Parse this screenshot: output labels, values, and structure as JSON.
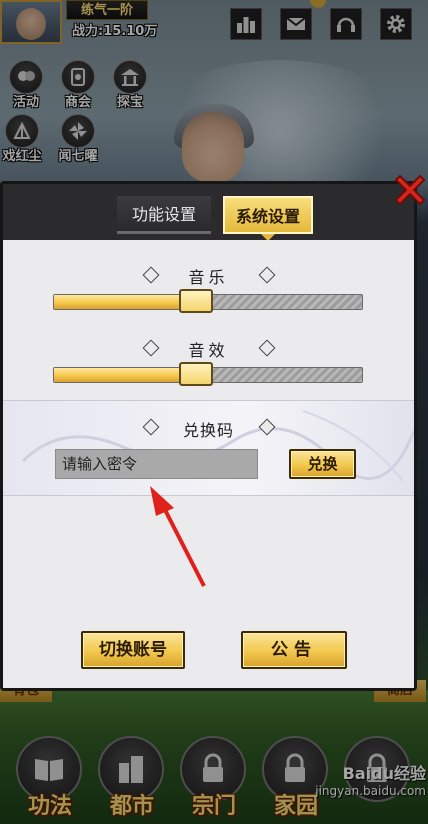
{
  "player": {
    "rank": "练气一阶",
    "power": "战力:15.10万"
  },
  "top_icons": [
    "ranking-icon",
    "mail-icon",
    "support-icon",
    "settings-icon"
  ],
  "side_menu": [
    {
      "label": "活动",
      "icon": "lantern-icon"
    },
    {
      "label": "商会",
      "icon": "shop-icon"
    },
    {
      "label": "探宝",
      "icon": "pavilion-icon"
    },
    {
      "label": "戏红尘",
      "icon": "fan-icon"
    },
    {
      "label": "闻七曜",
      "icon": "pinwheel-icon"
    }
  ],
  "banners": {
    "left": "背包",
    "right": "商店"
  },
  "bottom_nav": [
    {
      "label": "功法",
      "icon": "book-icon"
    },
    {
      "label": "都市",
      "icon": "building-icon"
    },
    {
      "label": "宗门",
      "icon": "lock-icon"
    },
    {
      "label": "家园",
      "icon": "lock-icon"
    },
    {
      "label": "",
      "icon": "lock-icon"
    }
  ],
  "modal": {
    "tabs": [
      {
        "label": "功能设置",
        "active": false
      },
      {
        "label": "系统设置",
        "active": true
      }
    ],
    "music": {
      "label": "音乐",
      "level": 0.41
    },
    "sound": {
      "label": "音效",
      "level": 0.41
    },
    "redeem": {
      "label": "兑换码",
      "placeholder": "请输入密令",
      "button": "兑换"
    },
    "switch_account": "切换账号",
    "notice": "公告"
  },
  "watermark": {
    "main": "Baidu经验",
    "sub": "jingyan.baidu.com"
  },
  "colors": {
    "gold": "#f2c84e",
    "panel": "#ebeaed",
    "frame": "#2b2a2c",
    "close": "#d9261c"
  }
}
